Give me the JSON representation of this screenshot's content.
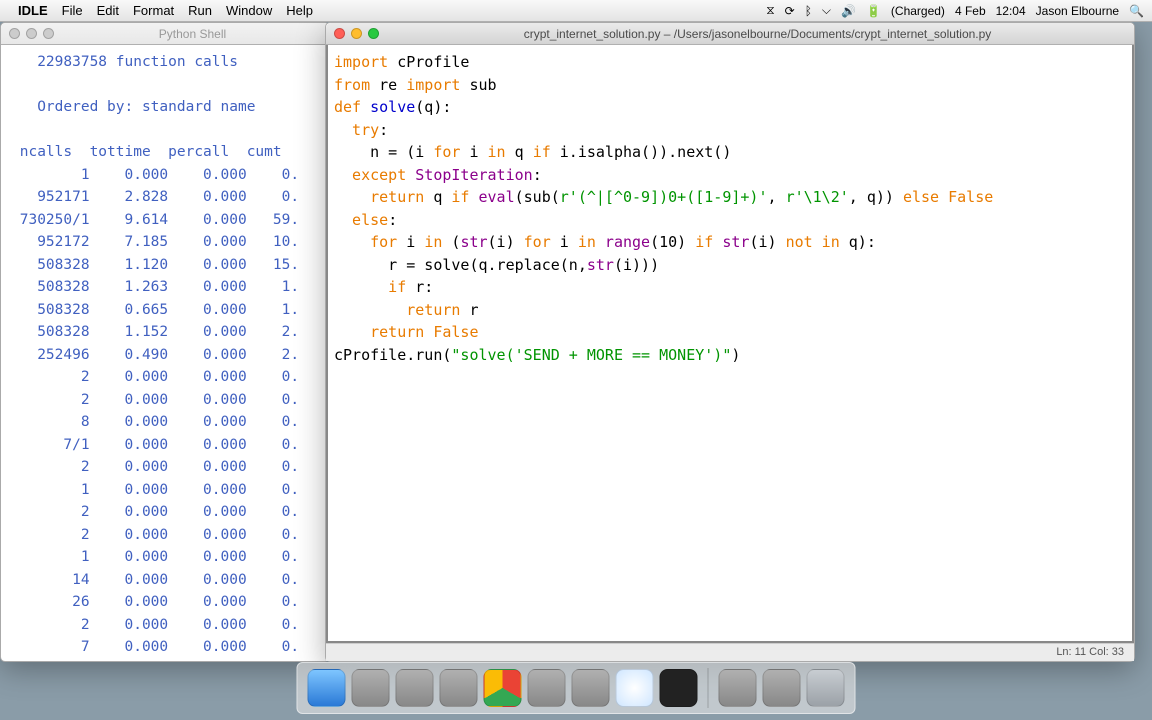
{
  "menubar": {
    "apple": "",
    "appname": "IDLE",
    "items": [
      "File",
      "Edit",
      "Format",
      "Run",
      "Window",
      "Help"
    ],
    "status": {
      "battery": "(Charged)",
      "date": "4 Feb",
      "time": "12:04",
      "user": "Jason Elbourne"
    }
  },
  "shell_window": {
    "title": "Python Shell",
    "header": "   22983758 function calls ",
    "ordered": "   Ordered by: standard name",
    "cols": " ncalls  tottime  percall  cumt",
    "rows": [
      [
        "1",
        "0.000",
        "0.000",
        "0."
      ],
      [
        "952171",
        "2.828",
        "0.000",
        "0."
      ],
      [
        "730250/1",
        "9.614",
        "0.000",
        "59."
      ],
      [
        "952172",
        "7.185",
        "0.000",
        "10."
      ],
      [
        "508328",
        "1.120",
        "0.000",
        "15."
      ],
      [
        "508328",
        "1.263",
        "0.000",
        "1."
      ],
      [
        "508328",
        "0.665",
        "0.000",
        "1."
      ],
      [
        "508328",
        "1.152",
        "0.000",
        "2."
      ],
      [
        "252496",
        "0.490",
        "0.000",
        "2."
      ],
      [
        "2",
        "0.000",
        "0.000",
        "0."
      ],
      [
        "2",
        "0.000",
        "0.000",
        "0."
      ],
      [
        "8",
        "0.000",
        "0.000",
        "0."
      ],
      [
        "7/1",
        "0.000",
        "0.000",
        "0."
      ],
      [
        "2",
        "0.000",
        "0.000",
        "0."
      ],
      [
        "1",
        "0.000",
        "0.000",
        "0."
      ],
      [
        "2",
        "0.000",
        "0.000",
        "0."
      ],
      [
        "2",
        "0.000",
        "0.000",
        "0."
      ],
      [
        "1",
        "0.000",
        "0.000",
        "0."
      ],
      [
        "14",
        "0.000",
        "0.000",
        "0."
      ],
      [
        "26",
        "0.000",
        "0.000",
        "0."
      ],
      [
        "2",
        "0.000",
        "0.000",
        "0."
      ],
      [
        "7",
        "0.000",
        "0.000",
        "0."
      ]
    ]
  },
  "editor_window": {
    "title": "crypt_internet_solution.py – /Users/jasonelbourne/Documents/crypt_internet_solution.py",
    "status": "Ln: 11  Col: 33",
    "code": {
      "l1a": "import",
      "l1b": " cProfile",
      "l2a": "from",
      "l2b": " re ",
      "l2c": "import",
      "l2d": " sub",
      "l3": "",
      "l4a": "def ",
      "l4b": "solve",
      "l4c": "(q):",
      "l5a": "  try",
      "l5b": ":",
      "l6a": "    n = (i ",
      "l6b": "for",
      "l6c": " i ",
      "l6d": "in",
      "l6e": " q ",
      "l6f": "if",
      "l6g": " i.isalpha()).next()",
      "l7a": "  except ",
      "l7b": "StopIteration",
      "l7c": ":",
      "l8a": "    return",
      "l8b": " q ",
      "l8c": "if",
      "l8d": " eval",
      "l8e": "(sub(",
      "l8f": "r'(^|[^0-9])0+([1-9]+)'",
      "l8g": ", ",
      "l8h": "r'\\1\\2'",
      "l8i": ", q)) ",
      "l8j": "else False",
      "l9a": "  else",
      "l9b": ":",
      "l10a": "    for",
      "l10b": " i ",
      "l10c": "in",
      "l10d": " (",
      "l10e": "str",
      "l10f": "(i) ",
      "l10g": "for",
      "l10h": " i ",
      "l10i": "in",
      "l10j": " range",
      "l10k": "(10) ",
      "l10l": "if",
      "l10m": " str",
      "l10n": "(i) ",
      "l10o": "not in",
      "l10p": " q):",
      "l11": "      r = solve(q.replace(n,",
      "l11b": "str",
      "l11c": "(i)))",
      "l12a": "      if",
      "l12b": " r:",
      "l13a": "        return",
      "l13b": " r",
      "l14a": "    return False",
      "l15": "",
      "l16a": "cProfile.run(",
      "l16b": "\"solve('SEND + MORE == MONEY')\"",
      "l16c": ")"
    }
  },
  "dock": {
    "items": [
      "finder",
      "grey",
      "grey",
      "grey",
      "chrome",
      "grey",
      "grey",
      "safari",
      "term",
      "sep",
      "grey",
      "grey",
      "trash"
    ]
  }
}
